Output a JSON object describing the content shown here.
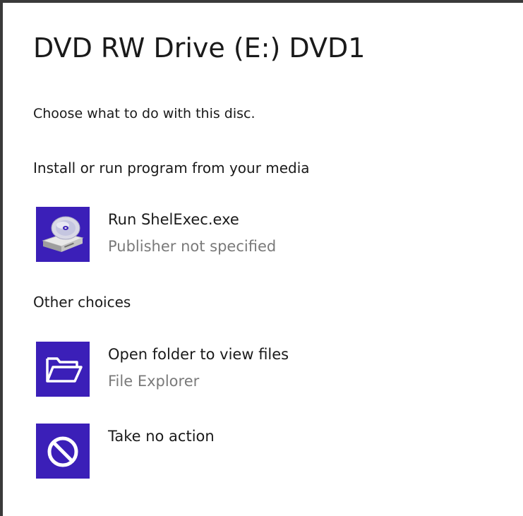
{
  "dialog": {
    "title": "DVD RW Drive (E:) DVD1",
    "subtitle": "Choose what to do with this disc.",
    "accent_color": "#3b1fb8"
  },
  "sections": {
    "install": {
      "heading": "Install or run program from your media",
      "option": {
        "icon": "disc-drive-icon",
        "title": "Run ShelExec.exe",
        "subtitle": "Publisher not specified"
      }
    },
    "other": {
      "heading": "Other choices",
      "options": [
        {
          "icon": "folder-open-icon",
          "title": "Open folder to view files",
          "subtitle": "File Explorer"
        },
        {
          "icon": "no-action-icon",
          "title": "Take no action"
        }
      ]
    }
  }
}
